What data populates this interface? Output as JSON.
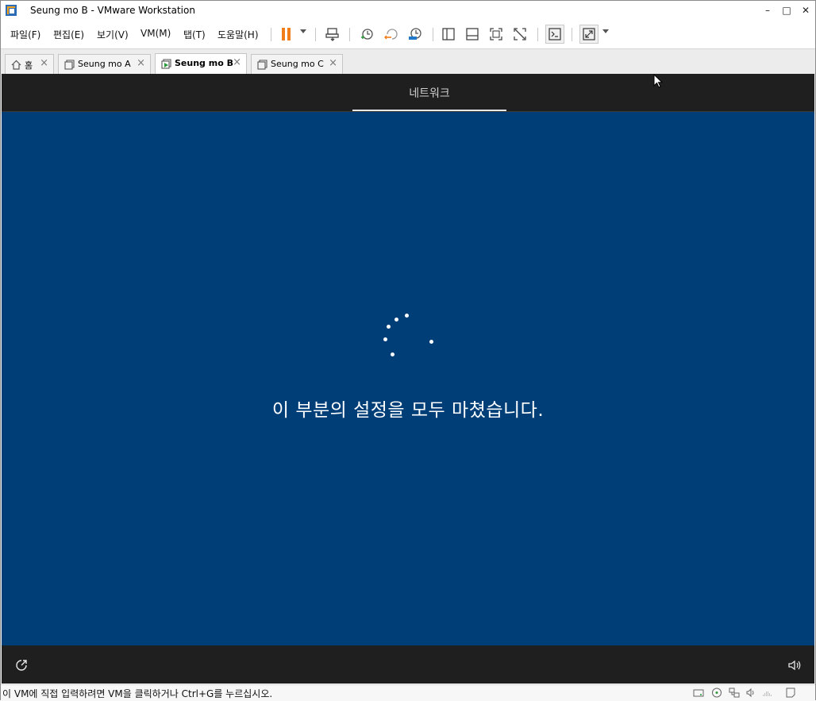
{
  "window": {
    "title": "Seung mo B - VMware Workstation",
    "controls": {
      "minimize": "–",
      "maximize": "□",
      "close": "✕"
    }
  },
  "menu": {
    "items": [
      "파일(F)",
      "편집(E)",
      "보기(V)",
      "VM(M)",
      "탭(T)",
      "도움말(H)"
    ]
  },
  "toolbar": {
    "icons": [
      "pause-icon",
      "send-ctrl-alt-del-icon",
      "snapshot-icon",
      "revert-snapshot-icon",
      "snapshot-manager-icon",
      "show-library-icon",
      "thumbnail-bar-icon",
      "full-screen-icon",
      "unity-icon",
      "console-view-icon",
      "stretch-guest-icon"
    ],
    "accent": "#f07c1a"
  },
  "tabs": [
    {
      "label": "홈",
      "icon": "home-icon",
      "active": false
    },
    {
      "label": "Seung mo A",
      "icon": "vm-icon",
      "active": false
    },
    {
      "label": "Seung mo B",
      "icon": "vm-running-icon",
      "active": true
    },
    {
      "label": "Seung mo C",
      "icon": "vm-icon",
      "active": false
    }
  ],
  "vm": {
    "header_tab": "네트워크",
    "message": "이 부분의 설정을 모두 마쳤습니다.",
    "background": "#003e78",
    "bar_color": "#1f1f1f",
    "bottom_left_icon": "ease-of-access-icon",
    "bottom_right_icon": "volume-icon"
  },
  "status": {
    "text": "이 VM에 직접 입력하려면 VM을 클릭하거나 Ctrl+G를 누르십시오.",
    "icons": [
      "hard-disk-icon",
      "cd-dvd-icon",
      "network-adapter-icon",
      "sound-card-icon",
      "display-icon",
      "message-log-icon"
    ]
  }
}
